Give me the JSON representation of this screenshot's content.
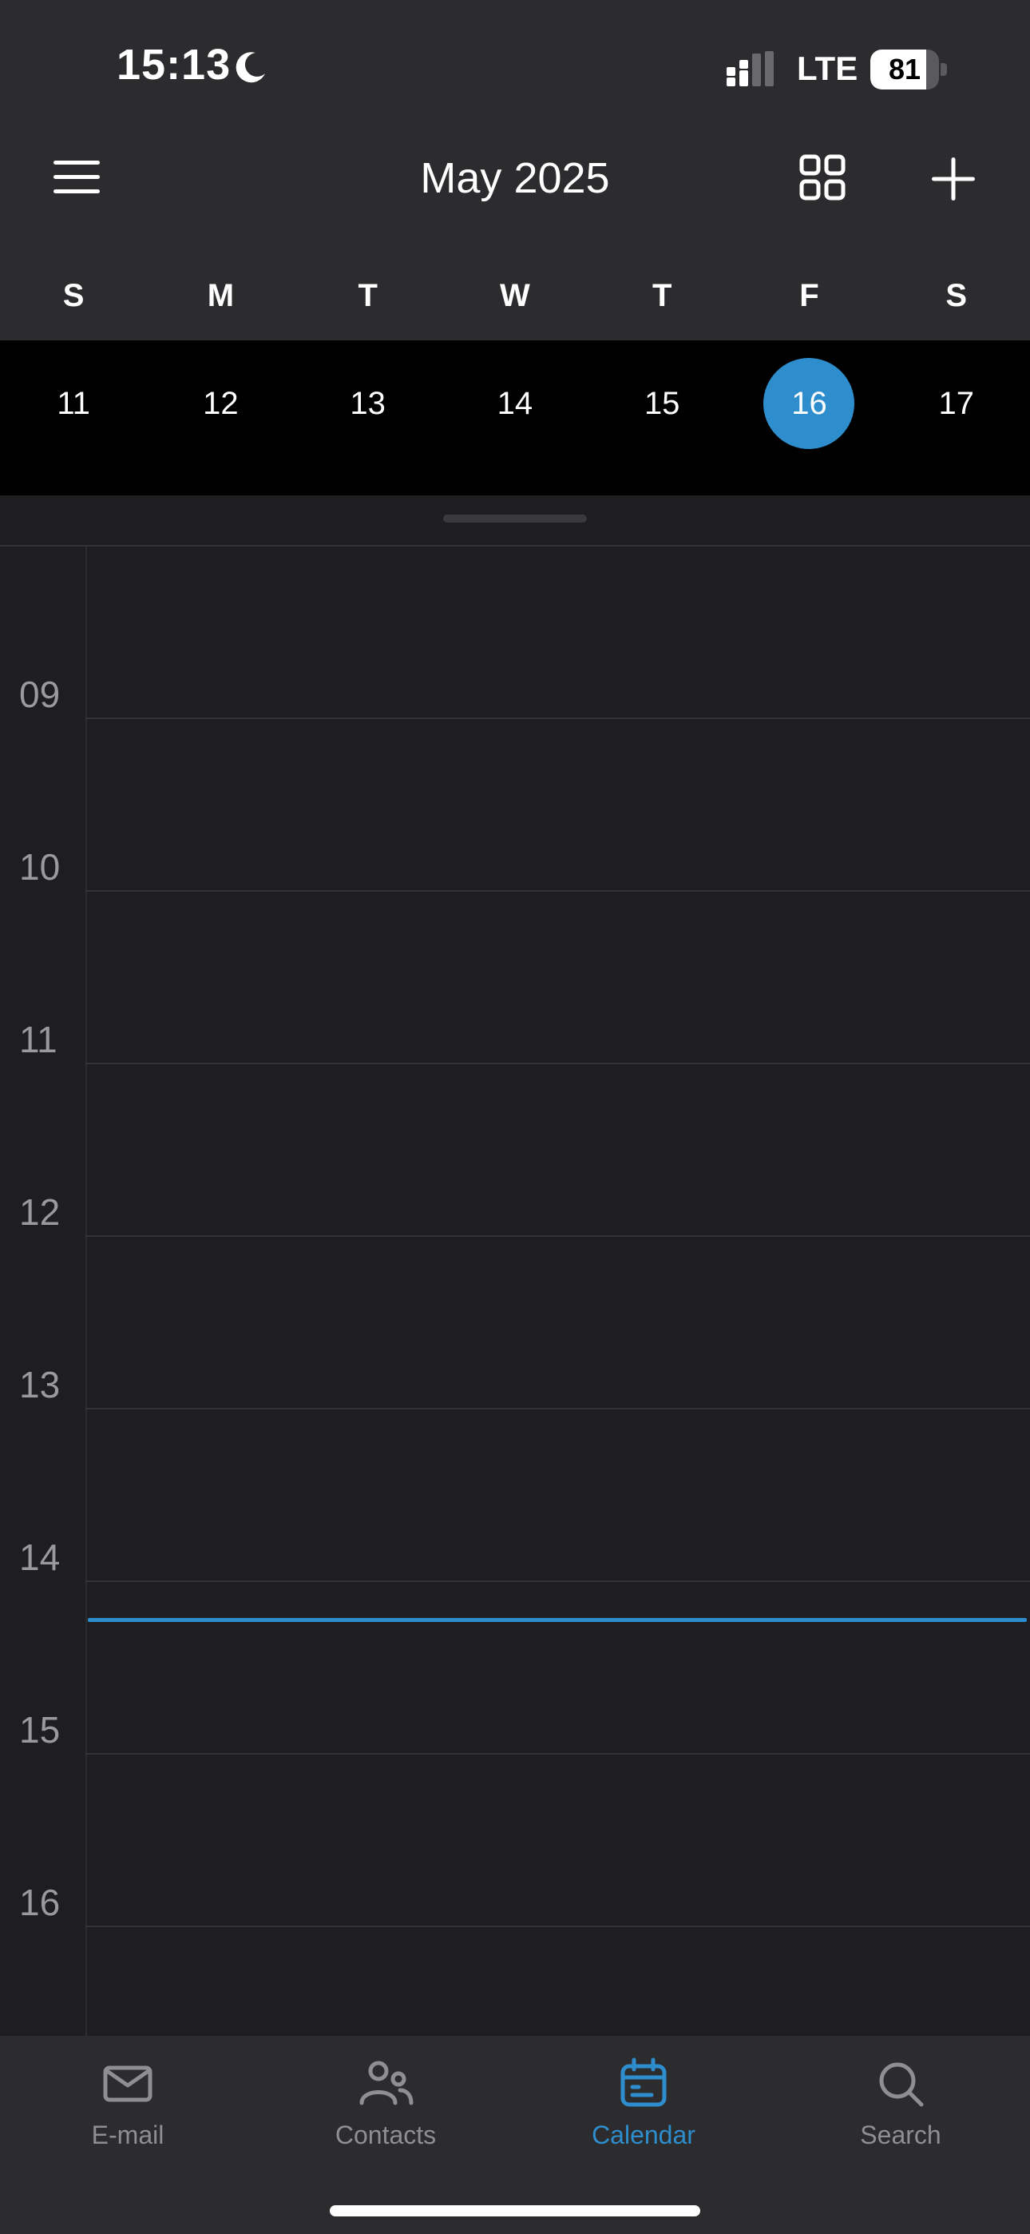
{
  "status_bar": {
    "time": "15:13",
    "network": "LTE",
    "battery": "81",
    "battery_level": 0.81
  },
  "header": {
    "title": "May 2025",
    "weekdays": [
      "S",
      "M",
      "T",
      "W",
      "T",
      "F",
      "S"
    ],
    "dates": [
      "11",
      "12",
      "13",
      "14",
      "15",
      "16",
      "17"
    ],
    "selected_date": "16"
  },
  "timeline": {
    "hours": [
      "09",
      "10",
      "11",
      "12",
      "13",
      "14",
      "15",
      "16"
    ],
    "current_time": "15:13"
  },
  "tabs": [
    {
      "label": "E-mail",
      "icon": "mail-icon"
    },
    {
      "label": "Contacts",
      "icon": "contacts-icon"
    },
    {
      "label": "Calendar",
      "icon": "calendar-icon",
      "active": true
    },
    {
      "label": "Search",
      "icon": "search-icon"
    }
  ],
  "colors": {
    "accent": "#2e8ecd",
    "header_bg": "#2c2c2e",
    "body_bg": "#1e1e20",
    "date_row_bg": "#000000"
  }
}
